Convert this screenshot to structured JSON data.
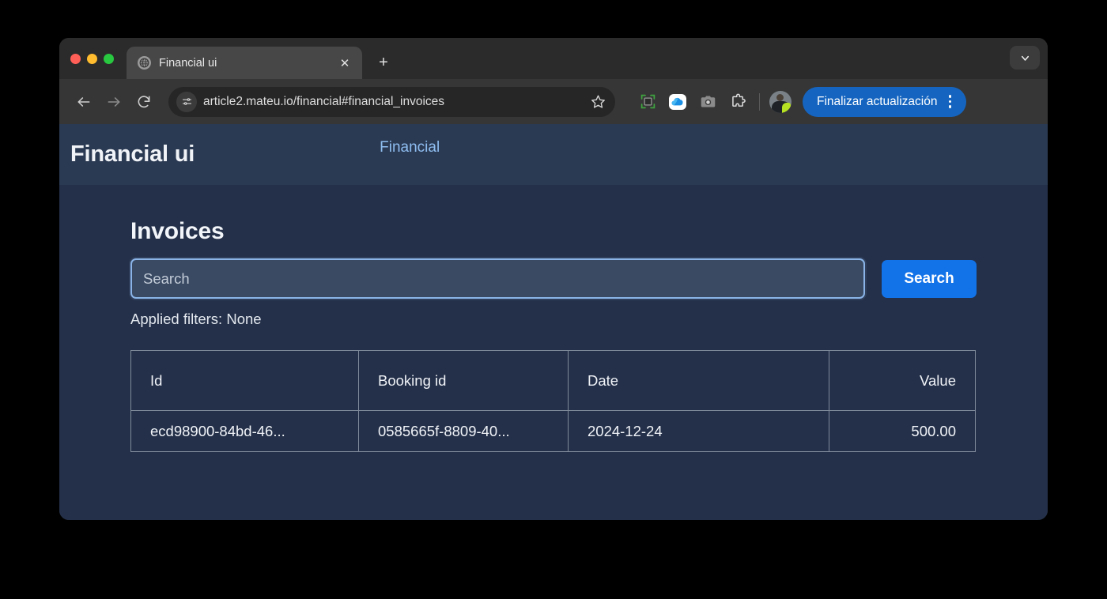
{
  "browser": {
    "tab": {
      "title": "Financial ui",
      "favicon": "globe-icon",
      "close_label": "✕"
    },
    "new_tab_label": "+",
    "tab_list_chevron": "chevron-down-icon",
    "toolbar": {
      "back": "back-arrow-icon",
      "forward": "forward-arrow-icon",
      "reload": "reload-icon",
      "site_info": "tune-icon",
      "url": "article2.mateu.io/financial#financial_invoices",
      "bookmark": "star-icon",
      "extensions": [
        "screen-capture-icon",
        "onedrive-cloud-icon",
        "camera-icon",
        "puzzle-extensions-icon"
      ],
      "profile": "avatar",
      "update_button_label": "Finalizar actualización",
      "menu": "kebab-menu-icon"
    }
  },
  "site": {
    "navbar": {
      "brand": "Financial ui",
      "links": [
        {
          "label": "Financial"
        }
      ]
    },
    "main": {
      "title": "Invoices",
      "search": {
        "value": "",
        "placeholder": "Search",
        "button_label": "Search"
      },
      "applied_filters": "Applied filters: None",
      "table": {
        "columns": [
          {
            "label": "Id",
            "align": "left"
          },
          {
            "label": "Booking id",
            "align": "left"
          },
          {
            "label": "Date",
            "align": "left"
          },
          {
            "label": "Value",
            "align": "right"
          }
        ],
        "rows": [
          {
            "id": "ecd98900-84bd-46...",
            "booking_id": "0585665f-8809-40...",
            "date": "2024-12-24",
            "value": "500.00"
          }
        ]
      }
    }
  },
  "colors": {
    "page_bg": "#243049",
    "navbar_bg": "#2b3a53",
    "accent_blue": "#1272e8",
    "link_blue": "#8ebdf0",
    "input_bg": "#3a4a63",
    "input_border": "#8ab4e8",
    "table_border": "#7f8a9b",
    "update_pill": "#1565c0"
  }
}
